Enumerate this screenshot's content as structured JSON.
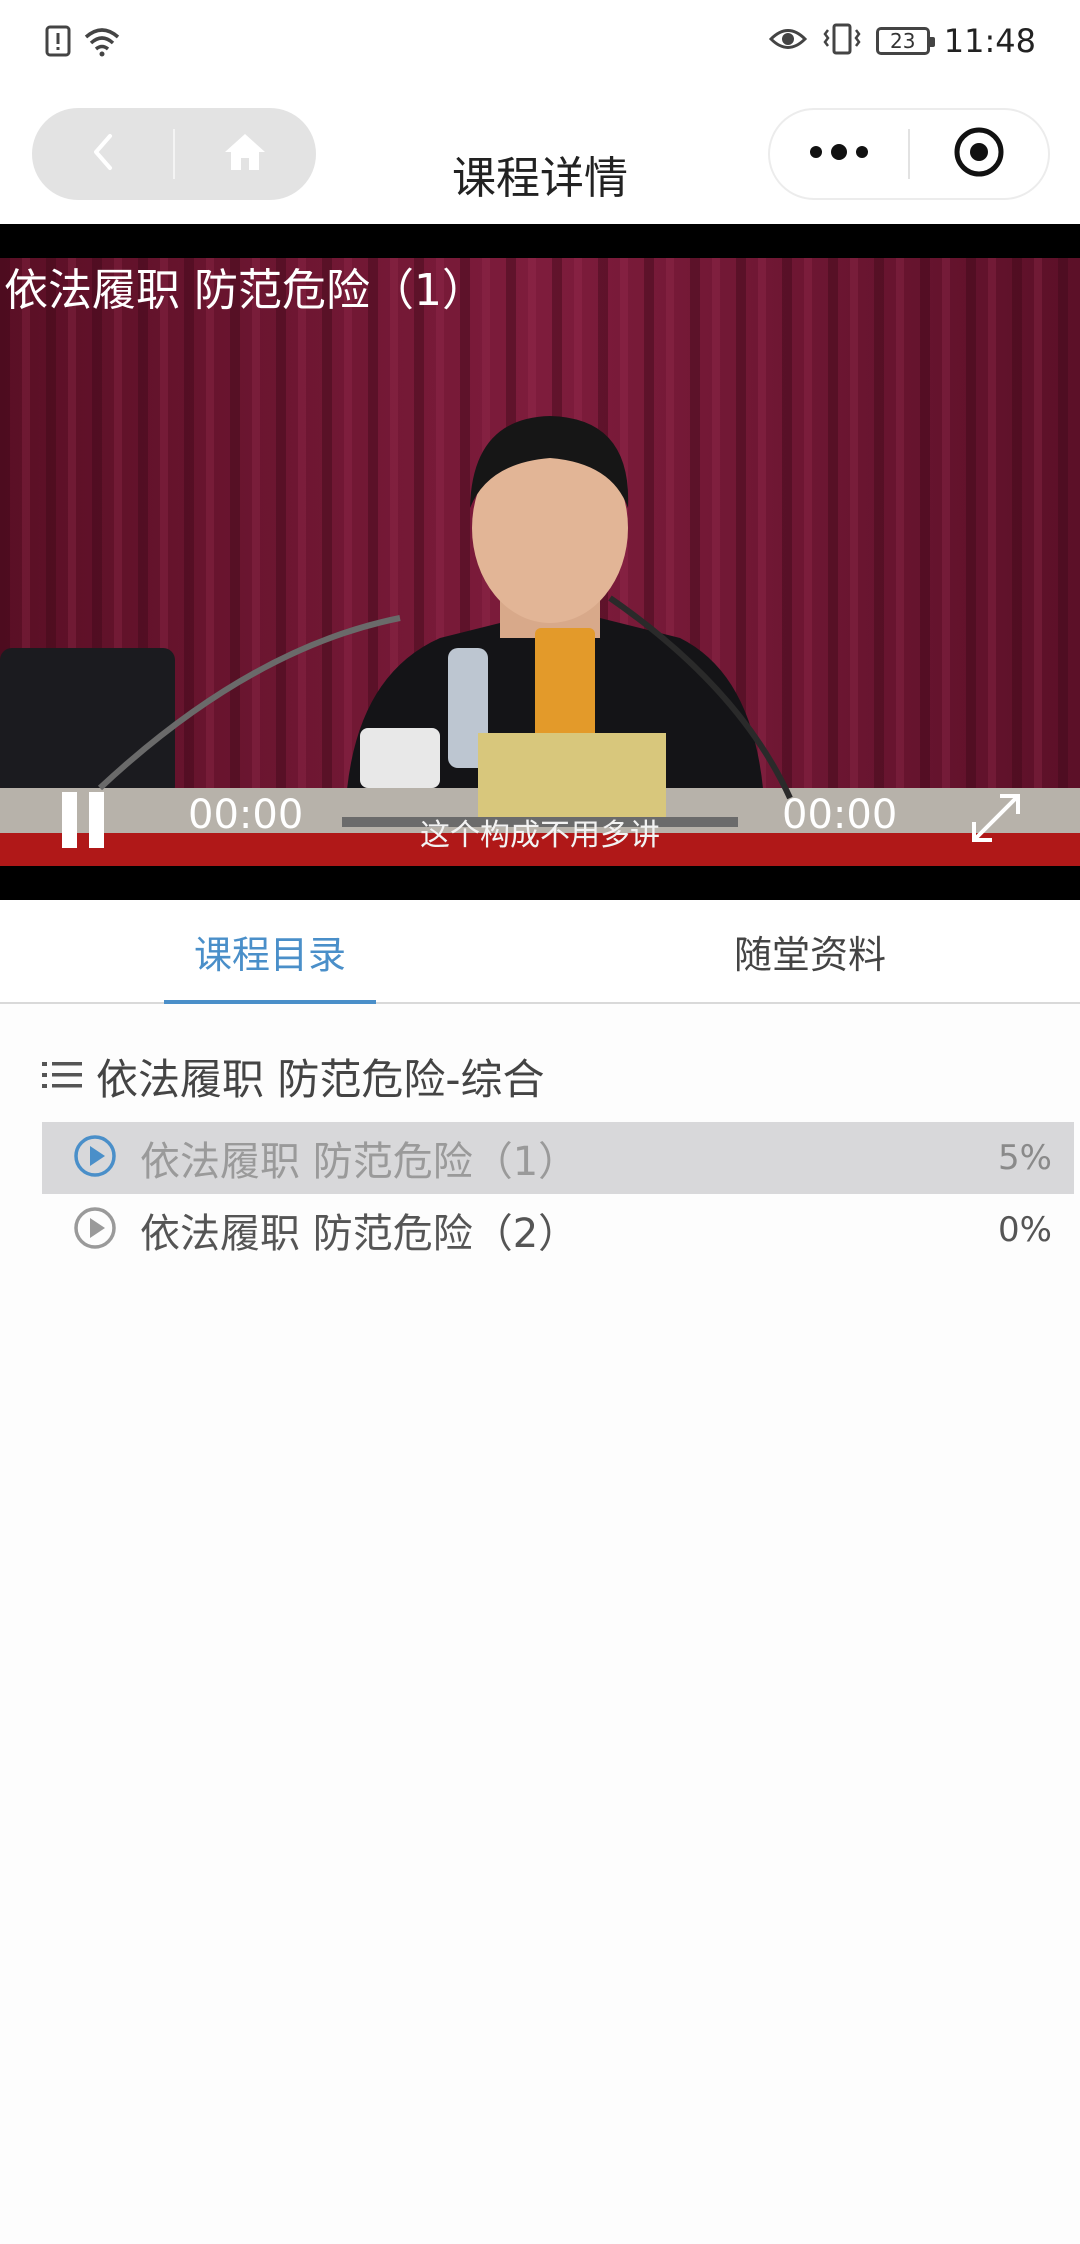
{
  "status_bar": {
    "time": "11:48",
    "battery": "23",
    "icons": [
      "alert-sim-icon",
      "wifi-icon",
      "eye-icon",
      "vibrate-icon",
      "battery-icon"
    ]
  },
  "nav": {
    "title": "课程详情",
    "back_icon": "chevron-left-icon",
    "home_icon": "home-icon",
    "more_icon": "more-dots-icon",
    "close_icon": "target-icon"
  },
  "video": {
    "title": "依法履职 防范危险（1）",
    "subtitle": "这个构成不用多讲",
    "current_time": "00:00",
    "total_time": "00:00",
    "progress_fraction": 0.0,
    "state": "playing"
  },
  "tabs": [
    {
      "label": "课程目录",
      "active": true
    },
    {
      "label": "随堂资料",
      "active": false
    }
  ],
  "chapter": {
    "title": "依法履职 防范危险-综合",
    "icon": "list-icon",
    "lessons": [
      {
        "label": "依法履职 防范危险（1）",
        "progress": "5%",
        "active": true
      },
      {
        "label": "依法履职 防范危险（2）",
        "progress": "0%",
        "active": false
      }
    ]
  },
  "colors": {
    "accent": "#4a8fc9",
    "active_row_bg": "#d8d8da",
    "video_bg": "#000000"
  }
}
